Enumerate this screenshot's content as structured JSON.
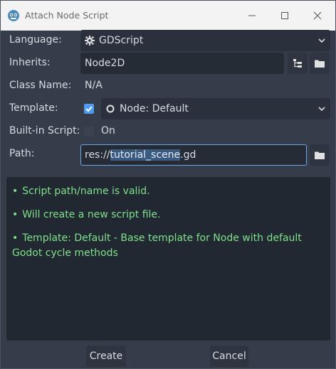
{
  "window": {
    "title": "Attach Node Script"
  },
  "form": {
    "language": {
      "label": "Language:",
      "value": "GDScript"
    },
    "inherits": {
      "label": "Inherits:",
      "value": "Node2D"
    },
    "class_name": {
      "label": "Class Name:",
      "value": "N/A"
    },
    "template": {
      "label": "Template:",
      "checked": true,
      "value": "Node: Default"
    },
    "builtin": {
      "label": "Built-in Script:",
      "checked": false,
      "toggle_text": "On"
    },
    "path": {
      "label": "Path:",
      "prefix": "res://",
      "selected": "tutorial_scene",
      "suffix": ".gd"
    }
  },
  "messages": [
    {
      "bullet": "•",
      "text": "Script path/name is valid."
    },
    {
      "bullet": "•",
      "text": "Will create a new script file."
    },
    {
      "bullet": "•",
      "text": "Template: Default - Base template for Node with default Godot cycle methods"
    }
  ],
  "buttons": {
    "create": "Create",
    "cancel": "Cancel"
  },
  "colors": {
    "accent": "#4e9cf0",
    "success_text": "#7fe08a"
  }
}
